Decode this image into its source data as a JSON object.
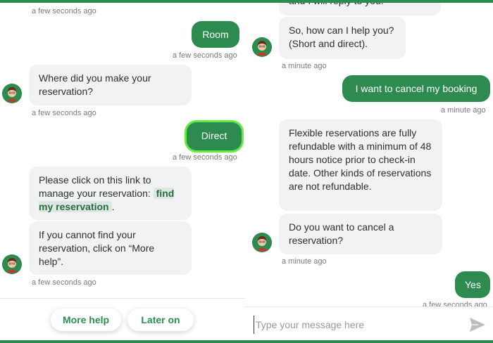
{
  "colors": {
    "accent": "#2e8b4f",
    "bubble_in": "#f1f2f4",
    "selected_ring": "#5dee3f"
  },
  "left": {
    "messages": [
      {
        "type": "ts",
        "text": "a few seconds ago"
      },
      {
        "type": "out",
        "text": "Room"
      },
      {
        "type": "ts",
        "text": "a few seconds ago"
      },
      {
        "type": "in",
        "text": "Where did you make your reservation?"
      },
      {
        "type": "ts",
        "text": "a few seconds ago"
      },
      {
        "type": "out",
        "text": "Direct"
      },
      {
        "type": "ts",
        "text": "a few seconds ago"
      },
      {
        "type": "in",
        "text_before": "Please click on this link to manage your reservation: ",
        "link": "find my reservation",
        "text_after": "."
      },
      {
        "type": "in",
        "text": "If you cannot find your reservation, click on “More help”."
      },
      {
        "type": "ts",
        "text": "a few seconds ago"
      }
    ],
    "quick_replies": [
      "More help",
      "Later on"
    ]
  },
  "right": {
    "messages": [
      {
        "type": "in",
        "text": "and I will reply to you."
      },
      {
        "type": "in",
        "text": "So, how can I help you? (Short and direct)."
      },
      {
        "type": "ts",
        "text": "a minute ago"
      },
      {
        "type": "out",
        "text": "I want to cancel my booking"
      },
      {
        "type": "ts",
        "text": "a minute ago"
      },
      {
        "type": "in",
        "text": "Flexible reservations are fully refundable with a minimum of 48 hours notice prior to check-in date. Other kinds of reservations are not refundable."
      },
      {
        "type": "in",
        "text": "Do you want to cancel a reservation?"
      },
      {
        "type": "ts",
        "text": "a minute ago"
      },
      {
        "type": "out",
        "text": "Yes"
      },
      {
        "type": "ts",
        "text": "a few seconds ago"
      }
    ],
    "input": {
      "placeholder": "Type your message here",
      "value": ""
    },
    "icons": {
      "send": "send-icon",
      "avatar": "agent-avatar-icon"
    }
  }
}
